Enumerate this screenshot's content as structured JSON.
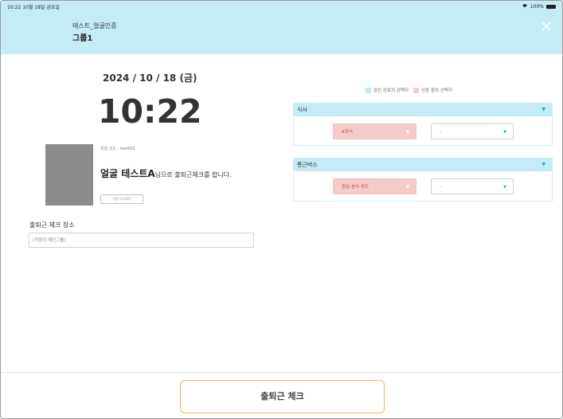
{
  "status_bar": {
    "time": "10:22",
    "date": "10월 18일 금요일",
    "battery": "100%",
    "wifi_icon": "wifi-icon",
    "battery_icon": "battery-icon"
  },
  "header": {
    "subtitle": "테스트_얼굴인증",
    "title": "그룹1",
    "close_icon": "close-icon"
  },
  "main": {
    "date": "2024 / 10 / 18 (금)",
    "clock": "10:22",
    "employee_code": "직원 코드 : test001",
    "user_name": "얼굴 테스트A",
    "user_suffix": "님으로 출퇴근체크를 합니다.",
    "reauth_label": "인증 다시하기",
    "location_label": "출퇴근 체크 장소",
    "location_placeholder": "(직원의 메인그룹)"
  },
  "legend": {
    "approved": "승인 완료의 선택지",
    "pending": "신청 중의 선택지",
    "approved_color": "#bfe9f8",
    "pending_color": "#f7cfcf"
  },
  "sections": [
    {
      "title": "식사",
      "selected": "A정식",
      "secondary": "-"
    },
    {
      "title": "통근버스",
      "selected": "잠실-본사 루트",
      "secondary": "-"
    }
  ],
  "footer": {
    "check_button": "출퇴근 체크"
  },
  "colors": {
    "header_bg": "#c4ecf5",
    "accent": "#1ba7d6",
    "button_border": "#f0b95a"
  }
}
